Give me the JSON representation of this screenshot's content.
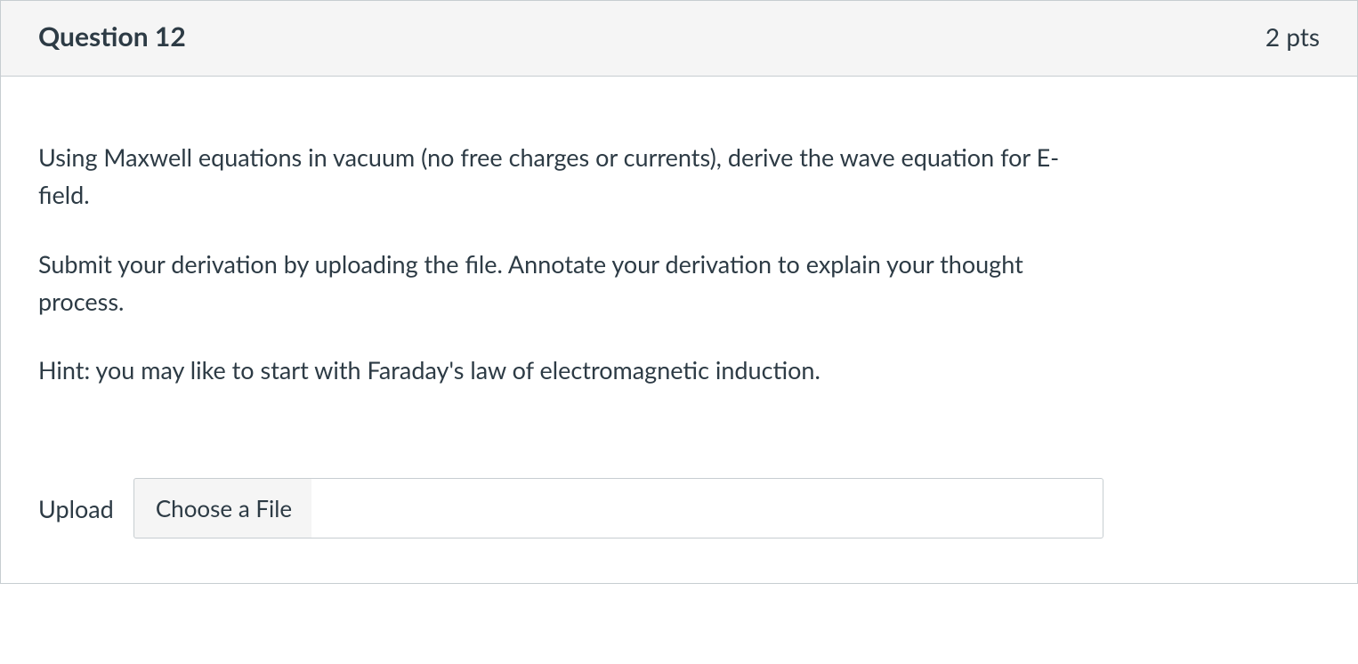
{
  "question": {
    "title": "Question 12",
    "points": "2 pts",
    "paragraphs": [
      "Using Maxwell equations in vacuum (no free charges or currents), derive the wave equation for E-field.",
      "Submit your derivation by uploading the file. Annotate your derivation to explain your thought process.",
      "Hint: you may like to start with Faraday's law of electromagnetic induction."
    ],
    "upload": {
      "label": "Upload",
      "button": "Choose a File"
    }
  }
}
